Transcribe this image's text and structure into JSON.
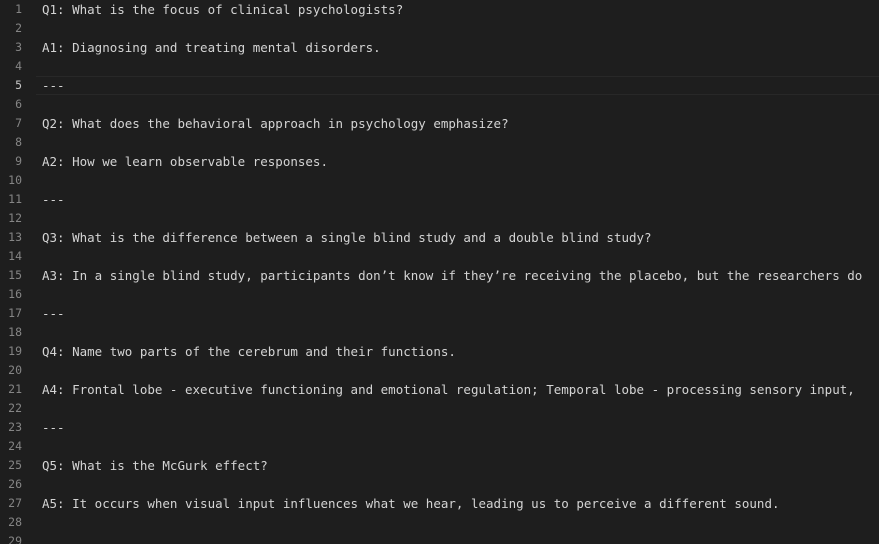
{
  "editor": {
    "lines": [
      {
        "num": "1",
        "text": "Q1: What is the focus of clinical psychologists?"
      },
      {
        "num": "2",
        "text": ""
      },
      {
        "num": "3",
        "text": "A1: Diagnosing and treating mental disorders."
      },
      {
        "num": "4",
        "text": ""
      },
      {
        "num": "5",
        "text": "---"
      },
      {
        "num": "6",
        "text": ""
      },
      {
        "num": "7",
        "text": "Q2: What does the behavioral approach in psychology emphasize?"
      },
      {
        "num": "8",
        "text": ""
      },
      {
        "num": "9",
        "text": "A2: How we learn observable responses."
      },
      {
        "num": "10",
        "text": ""
      },
      {
        "num": "11",
        "text": "---"
      },
      {
        "num": "12",
        "text": ""
      },
      {
        "num": "13",
        "text": "Q3: What is the difference between a single blind study and a double blind study?"
      },
      {
        "num": "14",
        "text": ""
      },
      {
        "num": "15",
        "text": "A3: In a single blind study, participants don’t know if they’re receiving the placebo, but the researchers do"
      },
      {
        "num": "16",
        "text": ""
      },
      {
        "num": "17",
        "text": "---"
      },
      {
        "num": "18",
        "text": ""
      },
      {
        "num": "19",
        "text": "Q4: Name two parts of the cerebrum and their functions."
      },
      {
        "num": "20",
        "text": ""
      },
      {
        "num": "21",
        "text": "A4: Frontal lobe - executive functioning and emotional regulation; Temporal lobe - processing sensory input,"
      },
      {
        "num": "22",
        "text": ""
      },
      {
        "num": "23",
        "text": "---"
      },
      {
        "num": "24",
        "text": ""
      },
      {
        "num": "25",
        "text": "Q5: What is the McGurk effect?"
      },
      {
        "num": "26",
        "text": ""
      },
      {
        "num": "27",
        "text": "A5: It occurs when visual input influences what we hear, leading us to perceive a different sound."
      },
      {
        "num": "28",
        "text": ""
      },
      {
        "num": "29",
        "text": ""
      }
    ],
    "current_line": "5"
  }
}
